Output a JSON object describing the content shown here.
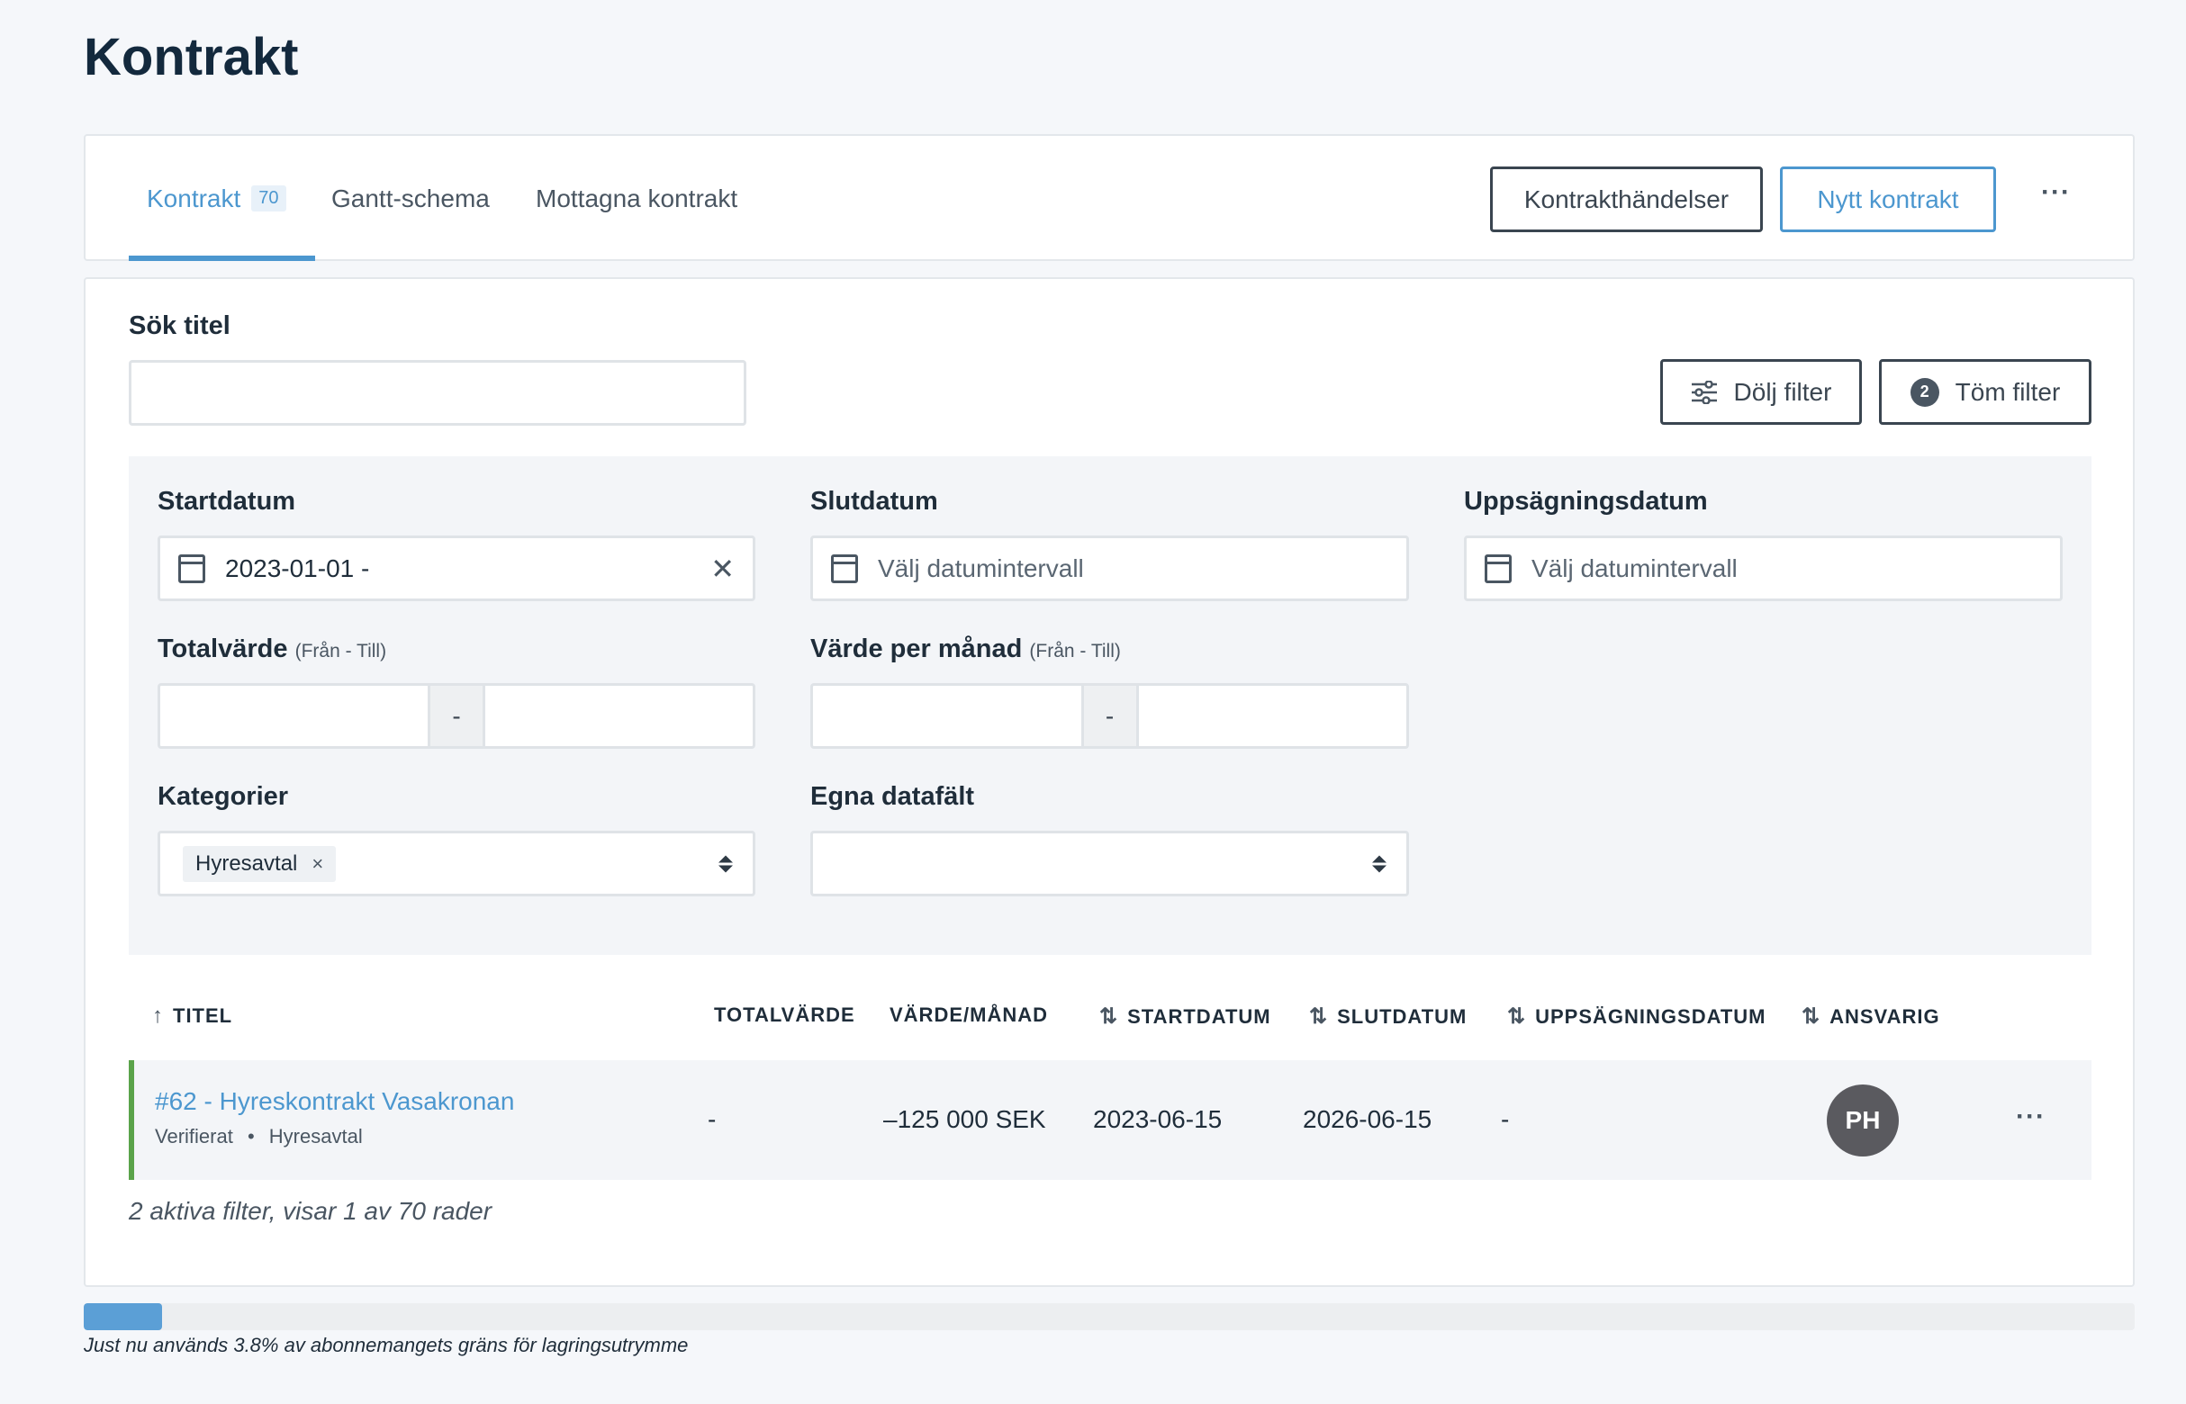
{
  "page": {
    "title": "Kontrakt"
  },
  "tabs": [
    {
      "label": "Kontrakt",
      "count": "70"
    },
    {
      "label": "Gantt-schema"
    },
    {
      "label": "Mottagna kontrakt"
    }
  ],
  "toolbar": {
    "events_label": "Kontrakthändelser",
    "new_label": "Nytt kontrakt",
    "more": "···"
  },
  "search": {
    "label": "Sök titel",
    "value": ""
  },
  "filter_actions": {
    "hide_label": "Dölj filter",
    "clear_label": "Töm filter",
    "clear_count": "2"
  },
  "filters": {
    "start": {
      "label": "Startdatum",
      "value": "2023-01-01 -",
      "clear": "✕"
    },
    "end": {
      "label": "Slutdatum",
      "placeholder": "Välj datumintervall"
    },
    "termination": {
      "label": "Uppsägningsdatum",
      "placeholder": "Välj datumintervall"
    },
    "total": {
      "label": "Totalvärde",
      "hint": "(Från - Till)",
      "sep": "-"
    },
    "monthly": {
      "label": "Värde per månad",
      "hint": "(Från - Till)",
      "sep": "-"
    },
    "categories": {
      "label": "Kategorier",
      "tag": "Hyresavtal",
      "tag_remove": "×"
    },
    "custom_fields": {
      "label": "Egna datafält"
    }
  },
  "table": {
    "columns": {
      "title": "TITEL",
      "total": "TOTALVÄRDE",
      "monthly": "VÄRDE/MÅNAD",
      "start": "STARTDATUM",
      "end": "SLUTDATUM",
      "termination": "UPPSÄGNINGSDATUM",
      "owner": "ANSVARIG"
    },
    "sort_icons": {
      "asc": "↑",
      "both": "⇅"
    },
    "rows": [
      {
        "title": "#62 - Hyreskontrakt Vasakronan",
        "status": "Verifierat",
        "dot": "•",
        "category": "Hyresavtal",
        "total": "-",
        "monthly": "–125 000 SEK",
        "start": "2023-06-15",
        "end": "2026-06-15",
        "termination": "-",
        "owner_initials": "PH",
        "more": "···",
        "status_color": "#5aa34a"
      }
    ],
    "footer": "2 aktiva filter, visar 1 av 70 rader"
  },
  "storage": {
    "percent": 3.8,
    "text": "Just nu används 3.8% av abonnemangets gräns för lagringsutrymme"
  },
  "colors": {
    "accent": "#4c97cf",
    "progress": "#5b9fd6",
    "success": "#5aa34a"
  }
}
